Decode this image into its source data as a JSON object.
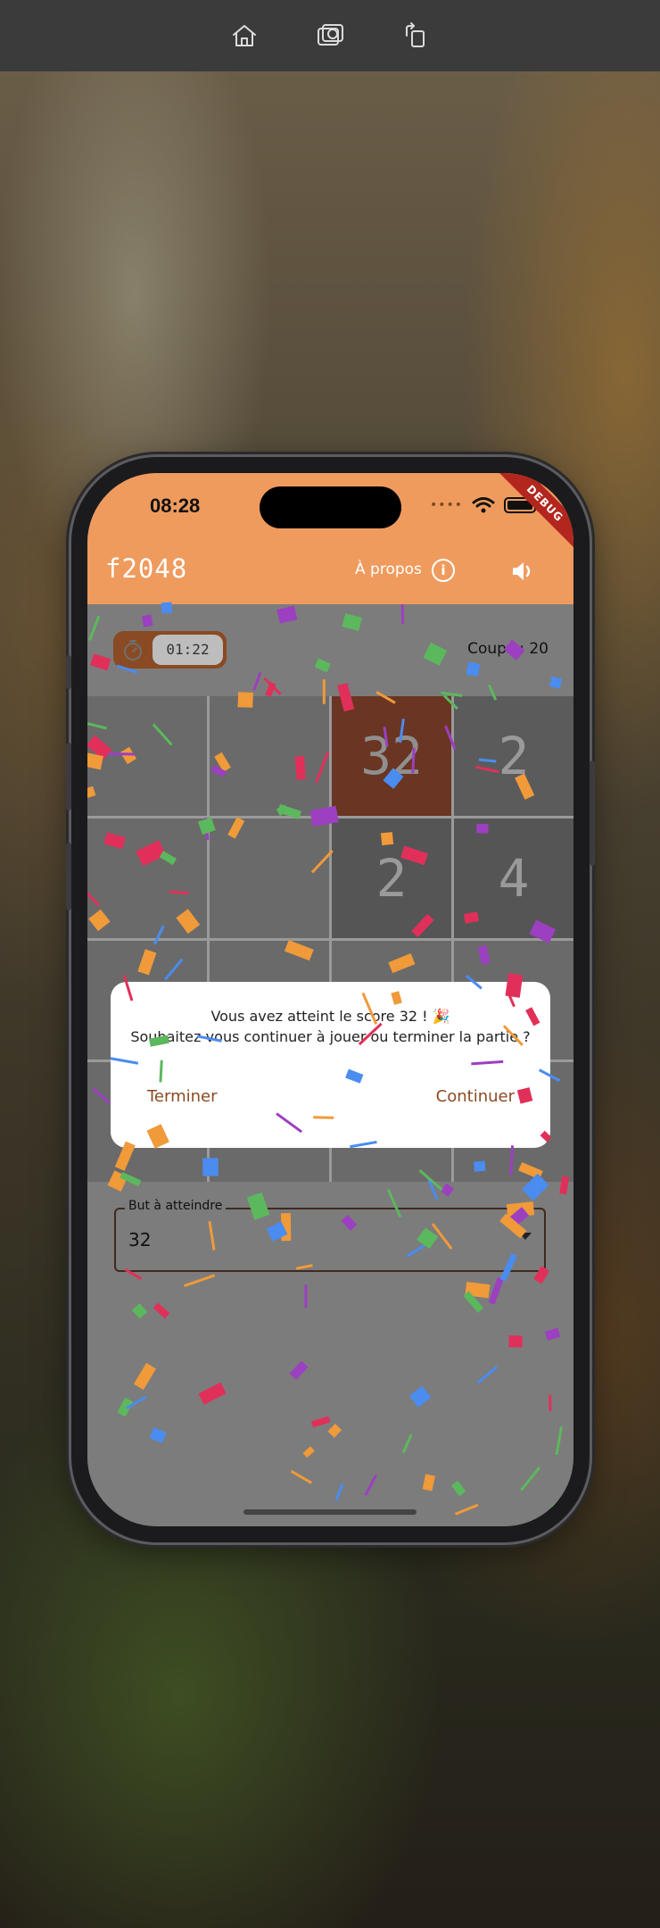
{
  "simulator_toolbar": {
    "icons": [
      "home-icon",
      "screenshot-icon",
      "rotate-icon"
    ]
  },
  "status_bar": {
    "time": "08:28",
    "debug_banner": "DEBUG"
  },
  "app_bar": {
    "title": "f2048",
    "about_label": "À propos",
    "info_icon": "i",
    "color": "#ef9b5e"
  },
  "stats": {
    "timer": "01:22",
    "moves": "Coups : 20"
  },
  "board": {
    "rows": [
      [
        "",
        "",
        "32",
        "2"
      ],
      [
        "",
        "",
        "2",
        "4"
      ],
      [
        "",
        "",
        "",
        ""
      ],
      [
        "",
        "",
        "",
        ""
      ]
    ]
  },
  "target": {
    "label": "But à atteindre",
    "value": "32"
  },
  "dialog": {
    "line1": "Vous avez atteint le score 32 ! 🎉",
    "line2": "Souhaitez-vous continuer à jouer ou terminer la partie ?",
    "end_label": "Terminer",
    "continue_label": "Continuer"
  },
  "colors": {
    "accent": "#8a4a23",
    "confetti": [
      "#4a8cf0",
      "#9c3fc0",
      "#f09a3a",
      "#5cb85c",
      "#e0305a"
    ]
  }
}
